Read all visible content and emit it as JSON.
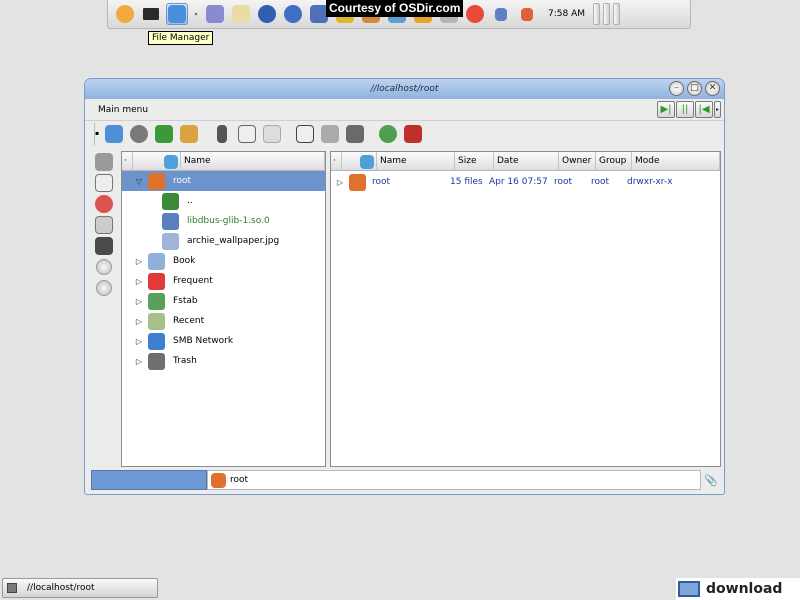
{
  "credit": "Courtesy of OSDir.com",
  "tooltip": "File Manager",
  "clock": "7:58 AM",
  "window": {
    "title": "//localhost/root",
    "menu_label": "Main menu",
    "min_glyph": "–",
    "max_glyph": "□",
    "close_glyph": "✕",
    "nav_glyphs": [
      "▶|",
      "||",
      "|◀"
    ]
  },
  "colors": {
    "selection": "#6b93cc",
    "link_blue": "#1b38a0",
    "link_green": "#2c7a2c"
  },
  "tree": {
    "header": "Name",
    "items": [
      {
        "label": "root",
        "icon": "home-folder-icon",
        "expanded": true,
        "selected": true,
        "level": 0
      },
      {
        "label": "..",
        "icon": "up-arrow-icon",
        "level": 1
      },
      {
        "label": "libdbus-glib-1.so.0",
        "icon": "library-file-icon",
        "level": 1,
        "color": "green"
      },
      {
        "label": "archie_wallpaper.jpg",
        "icon": "image-file-icon",
        "level": 1
      },
      {
        "label": "Book",
        "icon": "book-icon",
        "level": 0
      },
      {
        "label": "Frequent",
        "icon": "heart-icon",
        "level": 0
      },
      {
        "label": "Fstab",
        "icon": "drives-icon",
        "level": 0
      },
      {
        "label": "Recent",
        "icon": "recent-icon",
        "level": 0
      },
      {
        "label": "SMB Network",
        "icon": "network-icon",
        "level": 0
      },
      {
        "label": "Trash",
        "icon": "trash-icon",
        "level": 0
      }
    ]
  },
  "details": {
    "headers": [
      "Name",
      "Size",
      "Date",
      "Owner",
      "Group",
      "Mode"
    ],
    "rows": [
      {
        "name": "root",
        "size": "15 files",
        "date": "Apr 16 07:57",
        "owner": "root",
        "group": "root",
        "mode": "drwxr-xr-x"
      }
    ]
  },
  "location": {
    "value": "root"
  },
  "taskbar": {
    "window_label": "//localhost/root"
  },
  "brand": {
    "text": "download"
  }
}
